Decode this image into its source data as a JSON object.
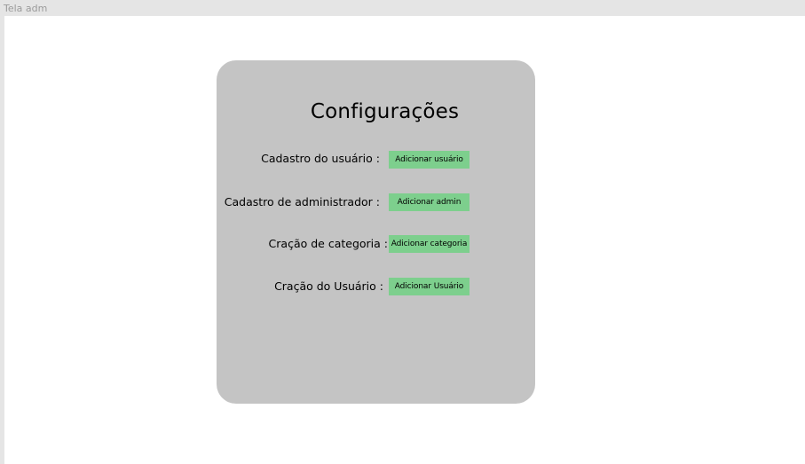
{
  "frame": {
    "title": "Tela adm"
  },
  "card": {
    "title": "Configurações",
    "rows": [
      {
        "label": "Cadastro do usuário :",
        "button": "Adicionar usuário"
      },
      {
        "label": "Cadastro de administrador :",
        "button": "Adicionar admin"
      },
      {
        "label": "Cração de categoria :",
        "button": "Adicionar categoria"
      },
      {
        "label": "Cração do Usuário :",
        "button": "Adicionar Usuário"
      }
    ]
  },
  "colors": {
    "frame_background": "#e5e5e5",
    "canvas_background": "#ffffff",
    "card_background": "#c4c4c4",
    "button_background": "#7dcf8d"
  }
}
